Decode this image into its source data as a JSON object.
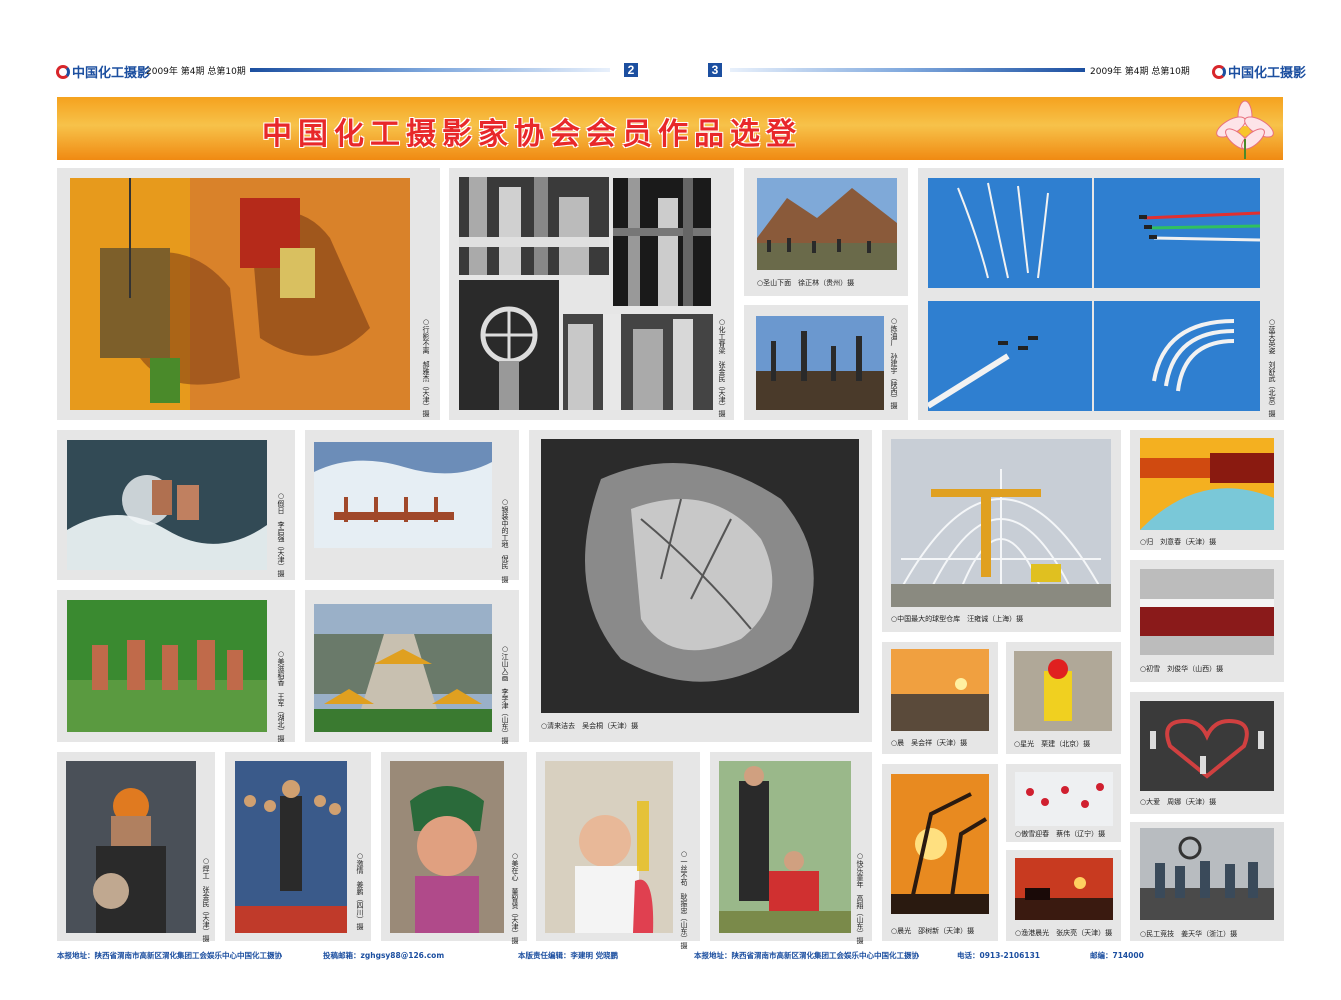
{
  "masthead": {
    "logo_text": "中国化工摄影",
    "issue_left": "2009年 第4期 总第10期",
    "issue_right": "2009年 第4期 总第10期",
    "page_left": "2",
    "page_right": "3"
  },
  "banner": {
    "title": "中国化工摄影家协会会员作品选登"
  },
  "captions": {
    "p1": "○行影不离　郝雅杰（天津）摄",
    "p2": "○化工脊梁　张金民（天津）摄",
    "p3": "○圣山下面　徐正林（贵州）摄",
    "p4": "○炼油厂　孙建宇（陕西）摄",
    "p5": "○蓝天英姿　刘舒武（北京）摄",
    "p6": "○假日　李启强（天津）摄",
    "p7": "○银装中的工地　倪民　摄",
    "p8": "○清来洁去　吴会桐（天津）摄",
    "p9": "○中国最大的球型仓库　汪雍诚（上海）摄",
    "p10": "○归　刘意春（天津）摄",
    "p11": "○美滋稻香　王军（湖北）摄",
    "p12": "○江山入画　李学津（山东）摄",
    "p13": "○初雪　刘俊华（山西）摄",
    "p14": "○晨　吴会祥（天津）摄",
    "p15": "○星光　栗建（北京）摄",
    "p16": "○大爱　周娜（天津）摄",
    "p17": "○焊工　张金民（天津）摄",
    "p18": "○激情　姜鹏（四川）摄",
    "p19": "○美在心　董智贤（天津）摄",
    "p20": "○一丝不苟　耿振忠（山东）摄",
    "p21": "○快乐童年　高翔（山东）摄",
    "p22": "○晨光　邵树新（天津）摄",
    "p23": "○傲雪迎春　蔡伟（辽宁）摄",
    "p24": "○渔港晨光　张庆亮（天津）摄",
    "p25": "○民工竞技　姜天华（浙江）摄"
  },
  "footer": {
    "address1": "本报地址：陕西省渭南市高新区渭化集团工会娱乐中心中国化工摄协",
    "email": "投稿邮箱：zghgsy88@126.com",
    "editor": "本版责任编辑：李建明  党晓鹏",
    "address2": "本报地址：陕西省渭南市高新区渭化集团工会娱乐中心中国化工摄协",
    "phone": "电话：0913-2106131",
    "postcode": "邮编：714000"
  },
  "colors": {
    "brand_blue": "#1c4fa0",
    "banner_orange": "#f5a21e",
    "title_red": "#e8282a",
    "panel_grey": "#e6e6e6"
  }
}
